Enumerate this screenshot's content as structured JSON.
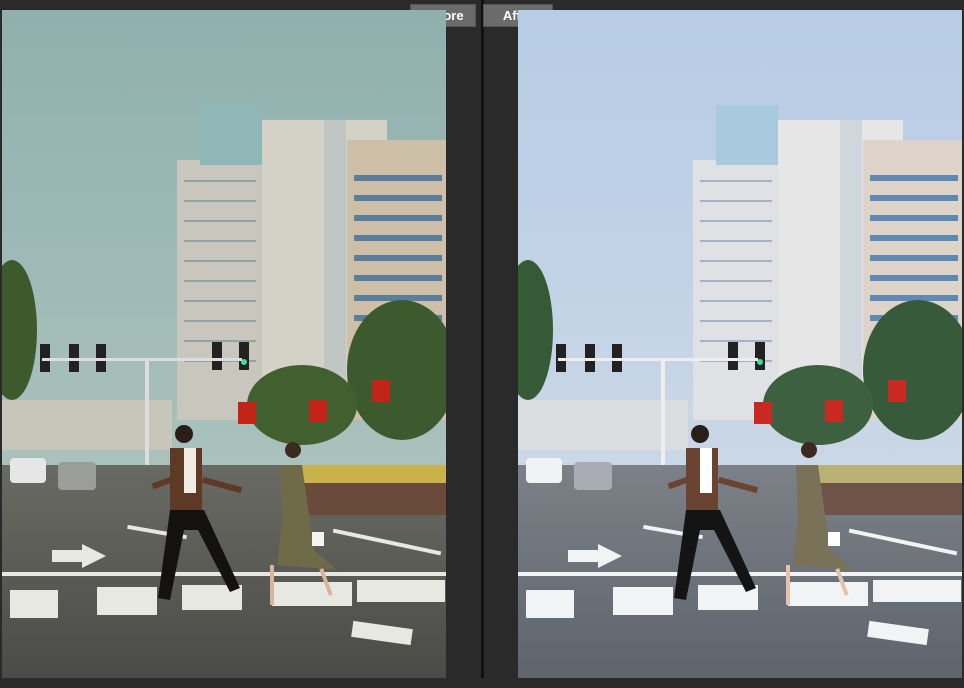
{
  "tabs": {
    "before_label": "Before",
    "after_label": "After"
  },
  "colors": {
    "before_sky": "#9fb9b6",
    "after_sky": "#c2d3e8",
    "road_before": "#5b5c58",
    "road_after": "#6e737b",
    "panel_bg": "#2a2a2a",
    "tab_bg": "#6b6b6b"
  },
  "icons": [
    "traffic-light-icon",
    "arrow-road-marking-icon"
  ]
}
